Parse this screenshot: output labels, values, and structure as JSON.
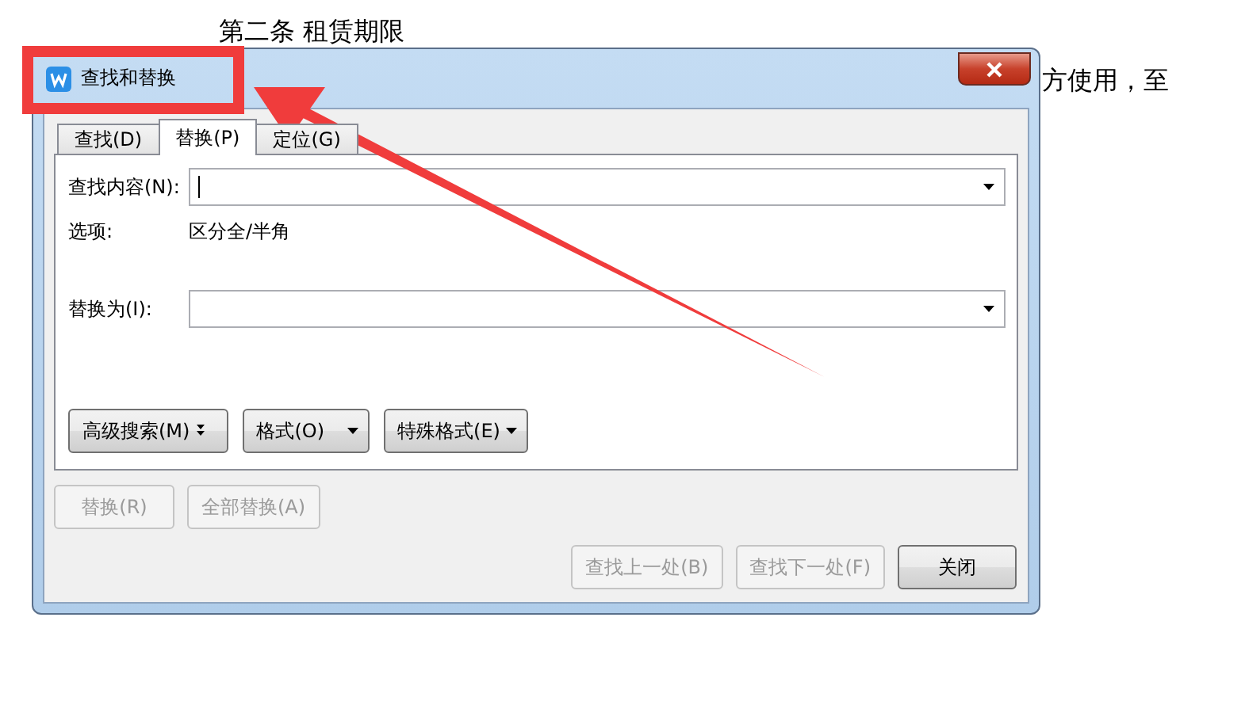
{
  "document": {
    "lines": [
      "第二条  租赁期限",
      "方使用，至"
    ]
  },
  "dialog": {
    "title": "查找和替换",
    "tabs": [
      {
        "label": "查找(D)",
        "selected": false
      },
      {
        "label": "替换(P)",
        "selected": true
      },
      {
        "label": "定位(G)",
        "selected": false
      }
    ],
    "find_label": "查找内容(N):",
    "options_label": "选项:",
    "options_value": "区分全/半角",
    "replace_label": "替换为(I):",
    "format_buttons": [
      {
        "label": "高级搜索(M)",
        "kind": "expand"
      },
      {
        "label": "格式(O)",
        "kind": "menu"
      },
      {
        "label": "特殊格式(E)",
        "kind": "menu"
      }
    ],
    "action_buttons": [
      {
        "label": "替换(R)",
        "disabled": true
      },
      {
        "label": "全部替换(A)",
        "disabled": true
      }
    ],
    "nav_buttons": [
      {
        "label": "查找上一处(B)",
        "disabled": true
      },
      {
        "label": "查找下一处(F)",
        "disabled": true
      },
      {
        "label": "关闭",
        "disabled": false
      }
    ]
  }
}
